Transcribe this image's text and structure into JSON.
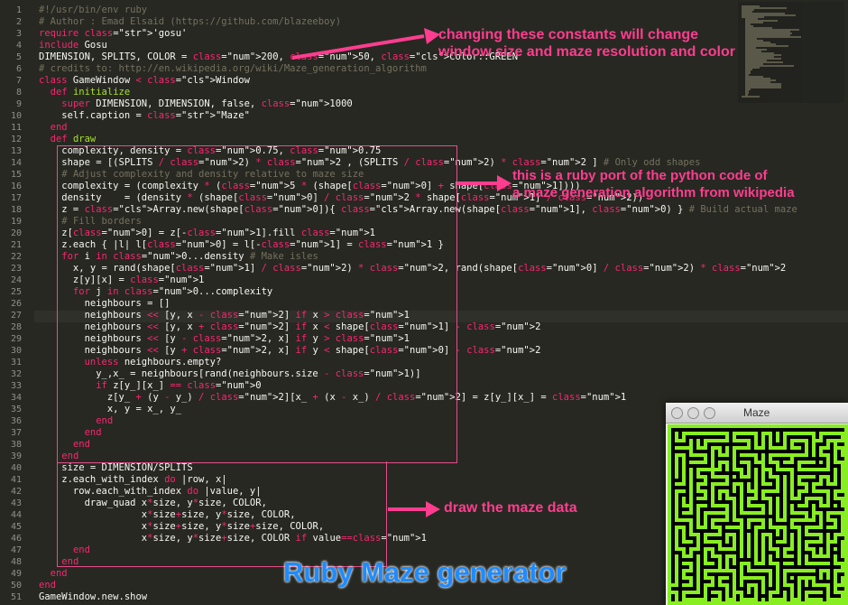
{
  "editor": {
    "line_numbers": [
      "1",
      "2",
      "3",
      "4",
      "5",
      "6",
      "7",
      "8",
      "9",
      "10",
      "11",
      "12",
      "13",
      "14",
      "15",
      "16",
      "17",
      "18",
      "19",
      "20",
      "21",
      "22",
      "23",
      "24",
      "25",
      "26",
      "27",
      "28",
      "29",
      "30",
      "31",
      "32",
      "33",
      "34",
      "35",
      "36",
      "37",
      "38",
      "39",
      "40",
      "41",
      "42",
      "43",
      "44",
      "45",
      "46",
      "47",
      "48",
      "49",
      "50",
      "51"
    ],
    "lines": [
      "#!/usr/bin/env ruby",
      "# Author : Emad Elsaid (https://github.com/blazeeboy)",
      "require 'gosu'",
      "include Gosu",
      "DIMENSION, SPLITS, COLOR = 200, 50, Color::GREEN",
      "# credits to: http://en.wikipedia.org/wiki/Maze_generation_algorithm",
      "class GameWindow < Window",
      "  def initialize",
      "    super DIMENSION, DIMENSION, false, 1000",
      "    self.caption = \"Maze\"",
      "  end",
      "  def draw",
      "    complexity, density = 0.75, 0.75",
      "    shape = [(SPLITS / 2) * 2 , (SPLITS / 2) * 2 ] # Only odd shapes",
      "    # Adjust complexity and density relative to maze size",
      "    complexity = (complexity * (5 * (shape[0] + shape[1])))",
      "    density    = (density * (shape[0] / 2 * shape[1] / 2))",
      "    z = Array.new(shape[0]){ Array.new(shape[1], 0) } # Build actual maze",
      "    # Fill borders",
      "    z[0] = z[-1].fill 1",
      "    z.each { |l| l[0] = l[-1] = 1 }",
      "    for i in 0...density # Make isles",
      "      x, y = rand(shape[1] / 2) * 2, rand(shape[0] / 2) * 2",
      "      z[y][x] = 1",
      "      for j in 0...complexity",
      "        neighbours = []",
      "        neighbours << [y, x - 2] if x > 1",
      "        neighbours << [y, x + 2] if x < shape[1] - 2",
      "        neighbours << [y - 2, x] if y > 1",
      "        neighbours << [y + 2, x] if y < shape[0] - 2",
      "        unless neighbours.empty?",
      "          y_,x_ = neighbours[rand(neighbours.size - 1)]",
      "          if z[y_][x_] == 0",
      "            z[y_ + (y - y_) / 2][x_ + (x - x_) / 2] = z[y_][x_] = 1",
      "            x, y = x_, y_",
      "          end",
      "        end",
      "      end",
      "    end",
      "    size = DIMENSION/SPLITS",
      "    z.each_with_index do |row, x|",
      "      row.each_with_index do |value, y|",
      "        draw_quad x*size, y*size, COLOR,",
      "                  x*size+size, y*size, COLOR,",
      "                  x*size+size, y*size+size, COLOR,",
      "                  x*size, y*size+size, COLOR if value==1",
      "      end",
      "    end",
      "  end",
      "end",
      "GameWindow.new.show"
    ]
  },
  "annotations": {
    "constants": [
      "changing these constants will change",
      "window size and maze resolution and color"
    ],
    "port": [
      "this is a ruby port of the python code of",
      "a maze generation algorithm from wikipedia"
    ],
    "draw": "draw the maze data",
    "title": "Ruby Maze generator"
  },
  "colors": {
    "annotation": "#ff3d8f",
    "maze_wall": "#88ee22",
    "title": "#1e8cff"
  },
  "maze_window": {
    "title": "Maze"
  }
}
